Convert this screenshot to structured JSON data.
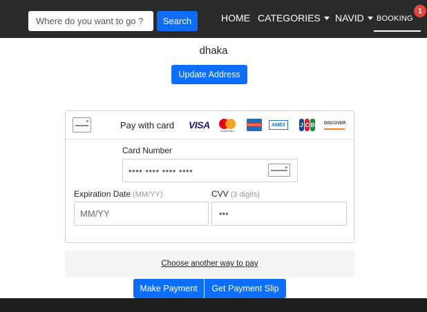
{
  "navbar": {
    "search_placeholder": "Where do you want to go ?",
    "search_label": "Search",
    "home_label": "HOME",
    "categories_label": "CATEGORIES",
    "user_label": "NAVID",
    "booking_label": "BOOKING",
    "booking_count": "1"
  },
  "address": {
    "city": "dhaka",
    "update_label": "Update Address"
  },
  "payment": {
    "pay_with_label": "Pay with card",
    "card_brands": [
      "visa",
      "mastercard",
      "diners-club",
      "amex",
      "jcb",
      "discover"
    ],
    "visa_text": "VISA",
    "mastercard_text": "mastercard",
    "diners_text": "DinersClub",
    "amex_text": "AMEX",
    "jcb_letters": [
      "J",
      "C",
      "B"
    ],
    "discover_text": "DISCOVER",
    "card_number_label": "Card Number",
    "card_number_placeholder": "•••• •••• •••• ••••",
    "expiration_label": "Expiration Date",
    "expiration_hint": "(MM/YY)",
    "expiration_placeholder": "MM/YY",
    "cvv_label": "CVV",
    "cvv_hint": "(3 digits)",
    "cvv_placeholder": "•••",
    "alt_payment_label": "Choose another way to pay"
  },
  "actions": {
    "make_payment_label": "Make Payment",
    "payment_slip_label": "Get Payment Slip"
  },
  "colors": {
    "navbar_bg": "#2b2b2b",
    "primary": "#0d6efd",
    "badge": "#e8453c"
  }
}
